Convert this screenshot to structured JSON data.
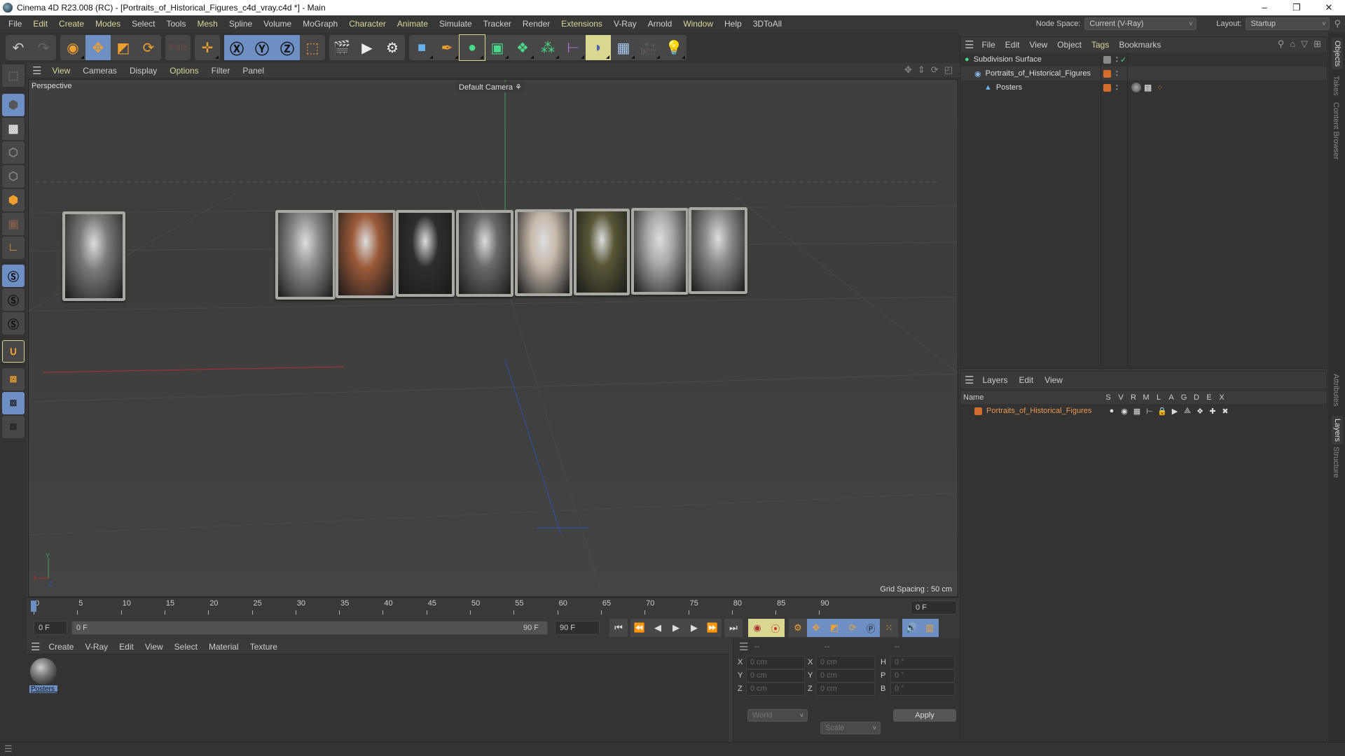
{
  "window": {
    "title": "Cinema 4D R23.008 (RC) - [Portraits_of_Historical_Figures_c4d_vray.c4d *] - Main",
    "controls": [
      "–",
      "❐",
      "✕"
    ]
  },
  "menubar": {
    "items": [
      {
        "label": "File",
        "hl": false
      },
      {
        "label": "Edit",
        "hl": true
      },
      {
        "label": "Create",
        "hl": true
      },
      {
        "label": "Modes",
        "hl": true
      },
      {
        "label": "Select",
        "hl": false
      },
      {
        "label": "Tools",
        "hl": false
      },
      {
        "label": "Mesh",
        "hl": true
      },
      {
        "label": "Spline",
        "hl": false
      },
      {
        "label": "Volume",
        "hl": false
      },
      {
        "label": "MoGraph",
        "hl": false
      },
      {
        "label": "Character",
        "hl": true
      },
      {
        "label": "Animate",
        "hl": true
      },
      {
        "label": "Simulate",
        "hl": false
      },
      {
        "label": "Tracker",
        "hl": false
      },
      {
        "label": "Render",
        "hl": false
      },
      {
        "label": "Extensions",
        "hl": true
      },
      {
        "label": "V-Ray",
        "hl": false
      },
      {
        "label": "Arnold",
        "hl": false
      },
      {
        "label": "Window",
        "hl": true
      },
      {
        "label": "Help",
        "hl": false
      },
      {
        "label": "3DToAll",
        "hl": false
      }
    ],
    "node_space_label": "Node Space:",
    "node_space_value": "Current (V-Ray)",
    "layout_label": "Layout:",
    "layout_value": "Startup"
  },
  "toolbar": {
    "undo": "undo-icon",
    "redo": "redo-icon",
    "tools": [
      "select-arrow-icon",
      "move-icon",
      "scale-icon",
      "rotate-icon",
      "psr-icon",
      "add-move-icon",
      "x-axis-icon",
      "y-axis-icon",
      "z-axis-icon",
      "coordinate-system-icon",
      "render-view-icon",
      "render-picture-viewer-icon",
      "render-settings-icon",
      "cube-icon",
      "pen-icon",
      "subdivision-icon",
      "extrude-icon",
      "cloner-icon",
      "array-icon",
      "symmetry-icon",
      "deformer-icon",
      "floor-icon",
      "camera-icon",
      "light-icon"
    ]
  },
  "viewport": {
    "menu": [
      {
        "label": "View",
        "hl": true
      },
      {
        "label": "Cameras",
        "hl": false
      },
      {
        "label": "Display",
        "hl": false
      },
      {
        "label": "Options",
        "hl": true
      },
      {
        "label": "Filter",
        "hl": false
      },
      {
        "label": "Panel",
        "hl": false
      }
    ],
    "view_name": "Perspective",
    "camera_name": "Default Camera",
    "grid_spacing": "Grid Spacing : 50 cm",
    "posters": [
      {
        "name": "poster-1",
        "tone": "#7a7a7a"
      },
      {
        "name": "poster-2",
        "tone": "#8c8c8c"
      },
      {
        "name": "poster-3",
        "tone": "#9a5a3a"
      },
      {
        "name": "poster-4",
        "tone": "#2e2e2e"
      },
      {
        "name": "poster-5",
        "tone": "#6a6a6a"
      },
      {
        "name": "poster-6",
        "tone": "#c4b8ac"
      },
      {
        "name": "poster-7",
        "tone": "#5a5638"
      },
      {
        "name": "poster-8",
        "tone": "#a8a8a8"
      },
      {
        "name": "poster-9",
        "tone": "#8a8a8a"
      }
    ]
  },
  "timeline": {
    "ticks": [
      "0",
      "5",
      "10",
      "15",
      "20",
      "25",
      "30",
      "35",
      "40",
      "45",
      "50",
      "55",
      "60",
      "65",
      "70",
      "75",
      "80",
      "85",
      "90"
    ],
    "current_frame": "0 F",
    "start_field": "0 F",
    "range_start": "0 F",
    "range_end": "90 F",
    "end_field": "90 F",
    "current_field": "0 F"
  },
  "material_manager": {
    "menu": [
      "Create",
      "V-Ray",
      "Edit",
      "View",
      "Select",
      "Material",
      "Texture"
    ],
    "materials": [
      {
        "name": "Posters_"
      }
    ]
  },
  "coordinates": {
    "headers": [
      "--",
      "--",
      "--"
    ],
    "rows": [
      {
        "a": "X",
        "av": "0 cm",
        "b": "X",
        "bv": "0 cm",
        "c": "H",
        "cv": "0 °"
      },
      {
        "a": "Y",
        "av": "0 cm",
        "b": "Y",
        "bv": "0 cm",
        "c": "P",
        "cv": "0 °"
      },
      {
        "a": "Z",
        "av": "0 cm",
        "b": "Z",
        "bv": "0 cm",
        "c": "B",
        "cv": "0 °"
      }
    ],
    "space": "World",
    "mode": "Scale",
    "apply": "Apply"
  },
  "object_manager": {
    "menu": [
      {
        "label": "File",
        "hl": false
      },
      {
        "label": "Edit",
        "hl": false
      },
      {
        "label": "View",
        "hl": false
      },
      {
        "label": "Object",
        "hl": false
      },
      {
        "label": "Tags",
        "hl": true
      },
      {
        "label": "Bookmarks",
        "hl": false
      }
    ],
    "objects": [
      {
        "name": "Subdivision Surface",
        "indent": 0,
        "icon": "subdivision-surface-icon"
      },
      {
        "name": "Portraits_of_Historical_Figures",
        "indent": 1,
        "icon": "null-object-icon"
      },
      {
        "name": "Posters",
        "indent": 2,
        "icon": "polygon-object-icon"
      }
    ]
  },
  "layer_manager": {
    "menu": [
      "Layers",
      "Edit",
      "View"
    ],
    "columns": [
      "Name",
      "S",
      "V",
      "R",
      "M",
      "L",
      "A",
      "G",
      "D",
      "E",
      "X"
    ],
    "layers": [
      {
        "name": "Portraits_of_Historical_Figures",
        "color": "#d36d2c"
      }
    ]
  },
  "side_tabs": {
    "top": [
      "Objects",
      "Takes",
      "Content Browser"
    ],
    "bottom": [
      "Attributes",
      "Layers",
      "Structure"
    ]
  },
  "colors": {
    "accent": "#f0a030",
    "selected": "#6e8fc4",
    "highlight_menu": "#d7d79a",
    "layer": "#d36d2c"
  }
}
